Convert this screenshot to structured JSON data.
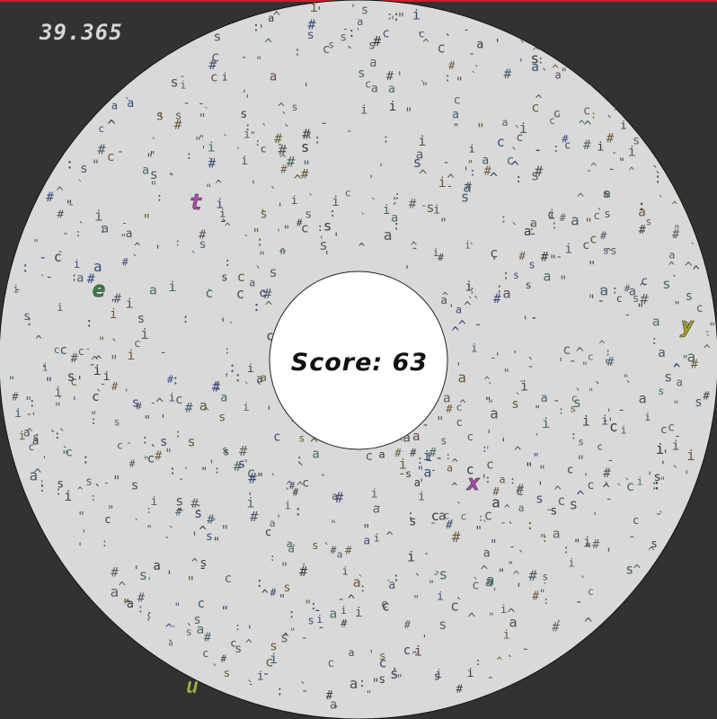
{
  "hud": {
    "timer": "39.365",
    "score_label": "Score: 63"
  },
  "colors": {
    "background": "#323232",
    "arena": "#d9d9d9",
    "center_hole": "#ffffff",
    "accent_bar": "#c8202a"
  },
  "letters": [
    {
      "char": "t",
      "color": "#b04ab0"
    },
    {
      "char": "e",
      "color": "#2f8a3a"
    },
    {
      "char": "y",
      "color": "#b0a020"
    },
    {
      "char": "x",
      "color": "#b04ab0"
    },
    {
      "char": "u",
      "color": "#a8b040"
    }
  ],
  "noise_glyphs": [
    "a",
    "c",
    "s",
    "i",
    "#",
    "^",
    "\"",
    "-",
    ":",
    "`",
    "'"
  ]
}
